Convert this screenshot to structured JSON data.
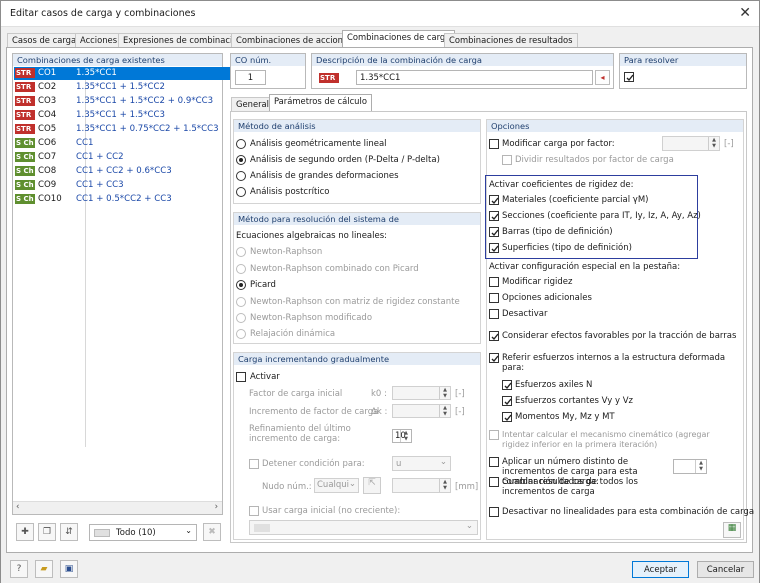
{
  "window": {
    "title": "Editar casos de carga y combinaciones"
  },
  "tabs": [
    "Casos de carga",
    "Acciones",
    "Expresiones de combinación",
    "Combinaciones de acciones",
    "Combinaciones de carga",
    "Combinaciones de resultados"
  ],
  "left": {
    "header": "Combinaciones de carga existentes",
    "rows": [
      {
        "badge": "STR",
        "code": "CO1",
        "expr": "1.35*CC1"
      },
      {
        "badge": "STR",
        "code": "CO2",
        "expr": "1.35*CC1 + 1.5*CC2"
      },
      {
        "badge": "STR",
        "code": "CO3",
        "expr": "1.35*CC1 + 1.5*CC2 + 0.9*CC3"
      },
      {
        "badge": "STR",
        "code": "CO4",
        "expr": "1.35*CC1 + 1.5*CC3"
      },
      {
        "badge": "STR",
        "code": "CO5",
        "expr": "1.35*CC1 + 0.75*CC2 + 1.5*CC3"
      },
      {
        "badge": "S Ch",
        "code": "CO6",
        "expr": "CC1"
      },
      {
        "badge": "S Ch",
        "code": "CO7",
        "expr": "CC1 + CC2"
      },
      {
        "badge": "S Ch",
        "code": "CO8",
        "expr": "CC1 + CC2 + 0.6*CC3"
      },
      {
        "badge": "S Ch",
        "code": "CO9",
        "expr": "CC1 + CC3"
      },
      {
        "badge": "S Ch",
        "code": "CO10",
        "expr": "CC1 + 0.5*CC2 + CC3"
      }
    ],
    "filter": "Todo (10)"
  },
  "co_num": {
    "label": "CO núm.",
    "value": "1"
  },
  "desc": {
    "label": "Descripción de la combinación de carga",
    "badge": "STR",
    "value": "1.35*CC1"
  },
  "to_solve": {
    "label": "Para resolver"
  },
  "subtabs": [
    "General",
    "Parámetros de cálculo"
  ],
  "analysis": {
    "header": "Método de análisis",
    "options": [
      "Análisis geométricamente lineal",
      "Análisis de segundo orden (P-Delta / P-delta)",
      "Análisis de grandes deformaciones",
      "Análisis postcrítico"
    ]
  },
  "solver": {
    "header": "Método para resolución del sistema de",
    "sub": "Ecuaciones algebraicas no lineales:",
    "options": [
      "Newton-Raphson",
      "Newton-Raphson combinado con Picard",
      "Picard",
      "Newton-Raphson con matriz de rigidez constante",
      "Newton-Raphson modificado",
      "Relajación dinámica"
    ]
  },
  "incremental": {
    "header": "Carga incrementando gradualmente",
    "activate": "Activar",
    "factor": "Factor de carga inicial",
    "factor_sym": "k0 :",
    "incr": "Incremento de factor de carga",
    "incr_sym": "Δk :",
    "refine": "Refinamiento del último incremento de carga:",
    "refine_val": "10",
    "unit_empty": "[-]",
    "stop": "Detener condición para:",
    "stop_val": "u",
    "node": "Nudo núm.:",
    "node_val": "Cualqui",
    "unit_mm": "[mm]",
    "initial": "Usar carga inicial (no creciente):"
  },
  "options": {
    "header": "Opciones",
    "modify": "Modificar carga por factor:",
    "divide": "Dividir resultados por factor de carga",
    "unit": "[-]",
    "stiff_title": "Activar coeficientes de rigidez de:",
    "stiff": [
      "Materiales (coeficiente parcial γM)",
      "Secciones (coeficiente para IT, Iy, Iz, A, Ay, Az)",
      "Barras (tipo de definición)",
      "Superficies (tipo de definición)"
    ],
    "special_title": "Activar configuración especial en la pestaña:",
    "special": [
      "Modificar rigidez",
      "Opciones adicionales",
      "Desactivar"
    ],
    "favorable": "Considerar efectos favorables por la tracción de barras",
    "refer": "Referir esfuerzos internos a la estructura deformada para:",
    "refer_items": [
      "Esfuerzos axiles N",
      "Esfuerzos cortantes Vy y Vz",
      "Momentos My, Mz y MT"
    ],
    "kinematic": "Intentar calcular el mecanismo cinemático (agregar rigidez inferior en la primera iteración)",
    "num_incr": "Aplicar un número distinto de incrementos de carga para esta combinación de carga:",
    "save_incr": "Guardar resultados de todos los incrementos de carga",
    "deactivate_nl": "Desactivar no linealidades para esta combinación de carga"
  },
  "buttons": {
    "accept": "Aceptar",
    "cancel": "Cancelar"
  }
}
